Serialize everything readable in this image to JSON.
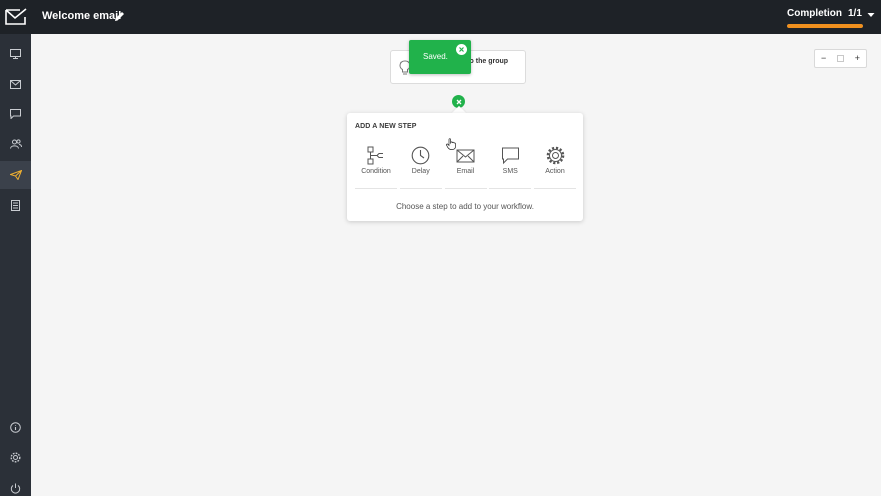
{
  "header": {
    "title": "Welcome email",
    "completion_label": "Completion",
    "completion_count": "1/1",
    "completion_progress": 1.0
  },
  "sidebar": {
    "items": [
      {
        "icon": "monitor-icon"
      },
      {
        "icon": "envelope-icon"
      },
      {
        "icon": "chat-icon"
      },
      {
        "icon": "contacts-icon"
      },
      {
        "icon": "paper-plane-icon",
        "active": true
      },
      {
        "icon": "document-icon"
      }
    ],
    "bottom_items": [
      {
        "icon": "info-icon"
      },
      {
        "icon": "gear-icon"
      },
      {
        "icon": "power-icon"
      }
    ]
  },
  "zoom": {
    "zoom_out": "−",
    "zoom_in": "+"
  },
  "trigger": {
    "text": "d to the group"
  },
  "toast": {
    "message": "Saved."
  },
  "panel": {
    "title": "ADD A NEW STEP",
    "steps": [
      {
        "label": "Condition",
        "icon": "condition-icon"
      },
      {
        "label": "Delay",
        "icon": "clock-icon"
      },
      {
        "label": "Email",
        "icon": "envelope-icon"
      },
      {
        "label": "SMS",
        "icon": "chat-bubble-icon"
      },
      {
        "label": "Action",
        "icon": "gear-icon"
      }
    ],
    "hint": "Choose a step to add to your workflow."
  },
  "colors": {
    "topbar": "#1e2227",
    "sidebar": "#2b3038",
    "accent_green": "#21b24b",
    "progress_orange": "#f0901e"
  }
}
